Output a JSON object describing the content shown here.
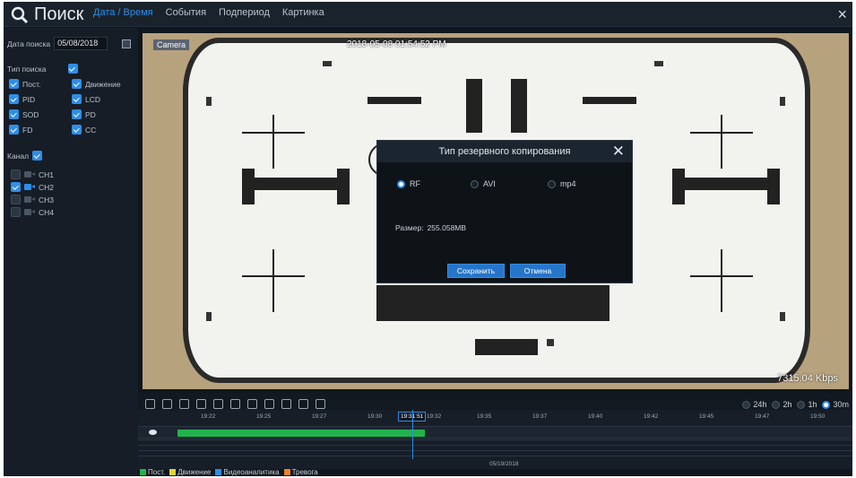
{
  "app": {
    "title": "Поиск",
    "close": "×",
    "accent": "#2f8ee5"
  },
  "tabs": [
    {
      "label": "Дата / Время",
      "active": true
    },
    {
      "label": "События",
      "active": false
    },
    {
      "label": "Подпериод",
      "active": false
    },
    {
      "label": "Картинка",
      "active": false
    }
  ],
  "left": {
    "search_date_label": "Дата поиска",
    "search_date_value": "05/08/2018",
    "search_type_label": "Тип поиска",
    "types": [
      {
        "label": "Пост.",
        "checked": true
      },
      {
        "label": "Движение",
        "checked": true
      },
      {
        "label": "PID",
        "checked": true
      },
      {
        "label": "LCD",
        "checked": true
      },
      {
        "label": "SOD",
        "checked": true
      },
      {
        "label": "PD",
        "checked": true
      },
      {
        "label": "FD",
        "checked": true
      },
      {
        "label": "CC",
        "checked": true
      }
    ],
    "channel_label": "Канал",
    "channels": [
      {
        "label": "CH1",
        "checked": false,
        "icon_color": "#4a5664"
      },
      {
        "label": "CH2",
        "checked": true,
        "icon_color": "#2f8ee5"
      },
      {
        "label": "CH3",
        "checked": false,
        "icon_color": "#4a5664"
      },
      {
        "label": "CH4",
        "checked": false,
        "icon_color": "#4a5664"
      }
    ]
  },
  "video": {
    "label": "Camera",
    "timestamp": "2018-05-08 01:54:52 PM",
    "bitrate": "7315.04 Kbps"
  },
  "modal": {
    "title": "Тип резервного копирования",
    "close": "✕",
    "options": [
      {
        "label": "RF",
        "selected": true
      },
      {
        "label": "AVI",
        "selected": false
      },
      {
        "label": "mp4",
        "selected": false
      }
    ],
    "size_label": "Размер:",
    "size_value": "255.058MB",
    "save": "Сохранить",
    "cancel": "Отмена"
  },
  "controls": {
    "icons": [
      "fit-screen-icon",
      "rewind-icon",
      "slow-play-icon",
      "pause-icon",
      "step-forward-icon",
      "stop-icon",
      "fast-forward-icon",
      "zoom-in-icon",
      "cut-icon",
      "volume-icon",
      "snapshot-icon"
    ],
    "zoom_options": [
      {
        "label": "24h",
        "selected": false
      },
      {
        "label": "2h",
        "selected": false
      },
      {
        "label": "1h",
        "selected": false
      },
      {
        "label": "30m",
        "selected": true
      }
    ]
  },
  "timeline": {
    "ticks": [
      "19:22",
      "19:25",
      "19:27",
      "19:30",
      "19:32",
      "19:35",
      "19:37",
      "19:40",
      "19:42",
      "19:45",
      "19:47",
      "19:50"
    ],
    "cursor_time": "19:31:51",
    "date": "05/19/2018"
  },
  "legend": [
    {
      "label": "Пост.",
      "color": "#22b24c"
    },
    {
      "label": "Движение",
      "color": "#e0d43a"
    },
    {
      "label": "Видеоаналитика",
      "color": "#2f8ee5"
    },
    {
      "label": "Тревога",
      "color": "#e8832a"
    }
  ]
}
